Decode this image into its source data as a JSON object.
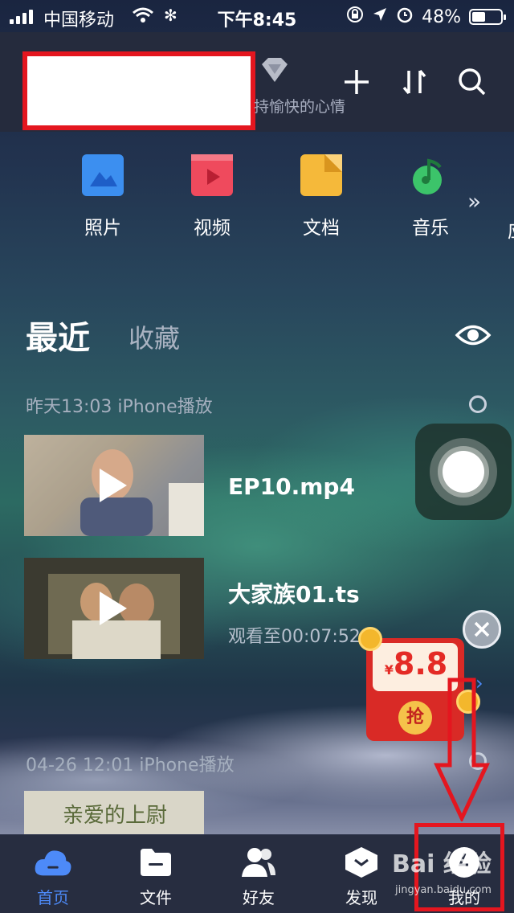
{
  "status_bar": {
    "carrier": "中国移动",
    "time": "下午8:45",
    "battery_percent": "48%",
    "battery_level": 0.48
  },
  "header": {
    "slogan": "持愉快的心情",
    "icons": [
      "vip-diamond-icon",
      "plus-icon",
      "sort-icon",
      "search-icon"
    ]
  },
  "quick_access": {
    "items": [
      {
        "label": "照片",
        "icon": "photo-icon",
        "color": "#3c8ff0"
      },
      {
        "label": "视频",
        "icon": "video-icon",
        "color": "#ef4a5d"
      },
      {
        "label": "文档",
        "icon": "document-icon",
        "color": "#f5b93a"
      },
      {
        "label": "音乐",
        "icon": "music-icon",
        "color": "#3cc46a"
      }
    ],
    "clipped_label": "应"
  },
  "tabs": {
    "recent": "最近",
    "favorites": "收藏"
  },
  "groups": [
    {
      "header": "昨天13:03 iPhone播放",
      "files": [
        {
          "name": "EP10.mp4",
          "sub": ""
        },
        {
          "name": "大家族01.ts",
          "sub": "观看至00:07:52"
        }
      ]
    },
    {
      "header": "04-26 12:01 iPhone播放",
      "files": [
        {
          "name": "",
          "sub": "",
          "thumb_caption": "亲爱的上尉"
        }
      ]
    }
  ],
  "red_packet": {
    "currency": "¥",
    "amount": "8.8",
    "button": "抢"
  },
  "tab_bar": {
    "items": [
      {
        "label": "首页",
        "icon": "home-cloud-icon",
        "active": true
      },
      {
        "label": "文件",
        "icon": "folder-icon",
        "active": false
      },
      {
        "label": "好友",
        "icon": "friends-icon",
        "active": false
      },
      {
        "label": "发现",
        "icon": "discover-icon",
        "active": false
      },
      {
        "label": "我的",
        "icon": "profile-icon",
        "active": false
      }
    ]
  },
  "watermark": {
    "brand": "Bai 经验",
    "url": "jingyan.baidu.com"
  },
  "colors": {
    "accent": "#4d8af8",
    "annotation_red": "#e4161f",
    "red_packet": "#d92a26"
  }
}
